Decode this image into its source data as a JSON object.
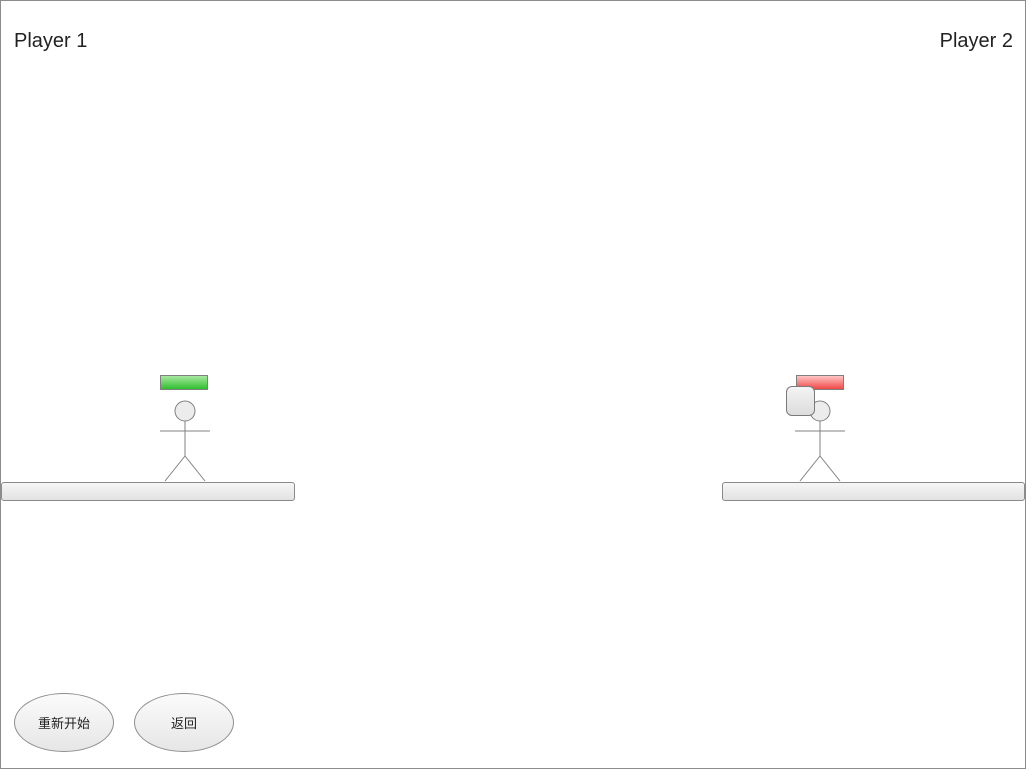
{
  "players": [
    {
      "label": "Player 1",
      "health_fraction": 1.0,
      "health_color_top": "#a8e8a0",
      "health_color_bottom": "#2fbf2f"
    },
    {
      "label": "Player 2",
      "health_fraction": 1.0,
      "health_color_top": "#ffc4c4",
      "health_color_bottom": "#f04848",
      "shield_visible": true
    }
  ],
  "buttons": {
    "restart_label": "重新开始",
    "back_label": "返回"
  }
}
